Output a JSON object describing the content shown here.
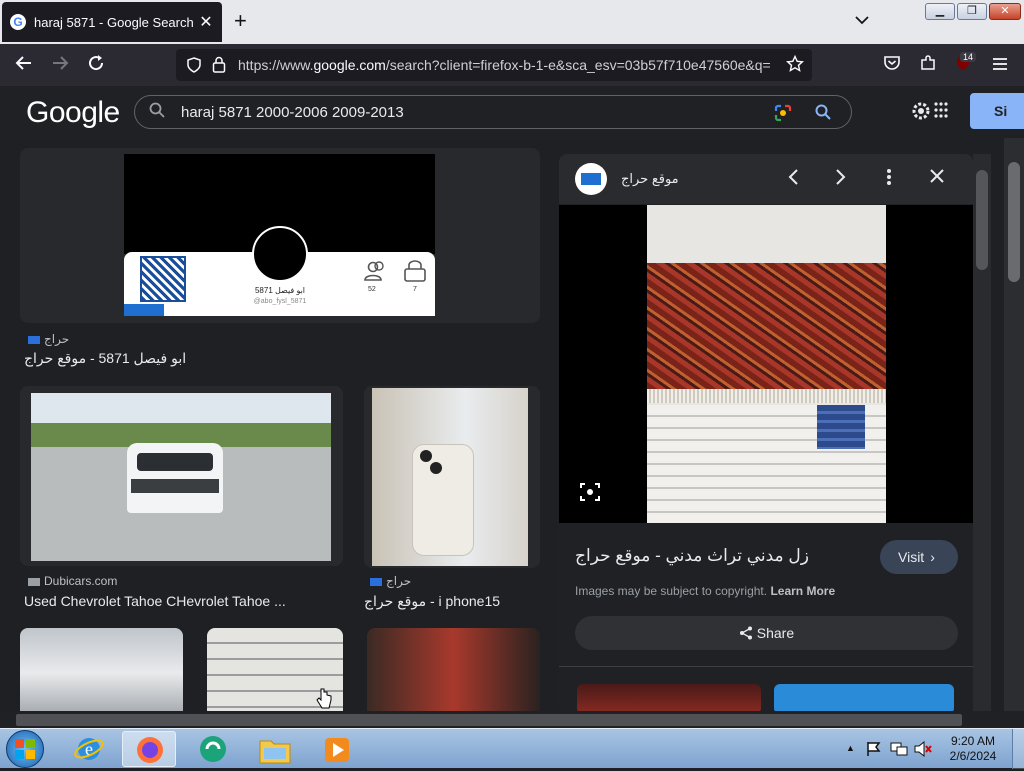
{
  "browser": {
    "tab_title": "haraj 5871 - Google Search",
    "url_prefix": "https://www.",
    "url_domain": "google.com",
    "url_rest": "/search?client=firefox-b-1-e&sca_esv=03b57f710e47560e&q=",
    "extensions_badge": "14"
  },
  "google": {
    "logo": "Google",
    "query": "haraj 5871 2000-2006 2009-2013",
    "signin_label": "Si"
  },
  "results": [
    {
      "source": "حراج",
      "caption": "ابو فيصل 5871 - موقع حراج",
      "profile_name": "ابو فيصل 5871",
      "profile_handle": "@abo_fysl_5871",
      "stat1": "52",
      "stat2": "7"
    },
    {
      "source": "Dubicars.com",
      "caption": "Used Chevrolet Tahoe CHevrolet Tahoe ..."
    },
    {
      "source": "حراج",
      "caption": "موقع حراج - i phone15"
    }
  ],
  "panel": {
    "site_name": "موقع حراج",
    "title": "زل مدني تراث مدني - موقع حراج",
    "visit_label": "Visit",
    "copyright_text": "Images may be subject to copyright.",
    "learn_more": "Learn More",
    "share_label": "Share"
  },
  "taskbar": {
    "time": "9:20 AM",
    "date": "2/6/2024"
  }
}
